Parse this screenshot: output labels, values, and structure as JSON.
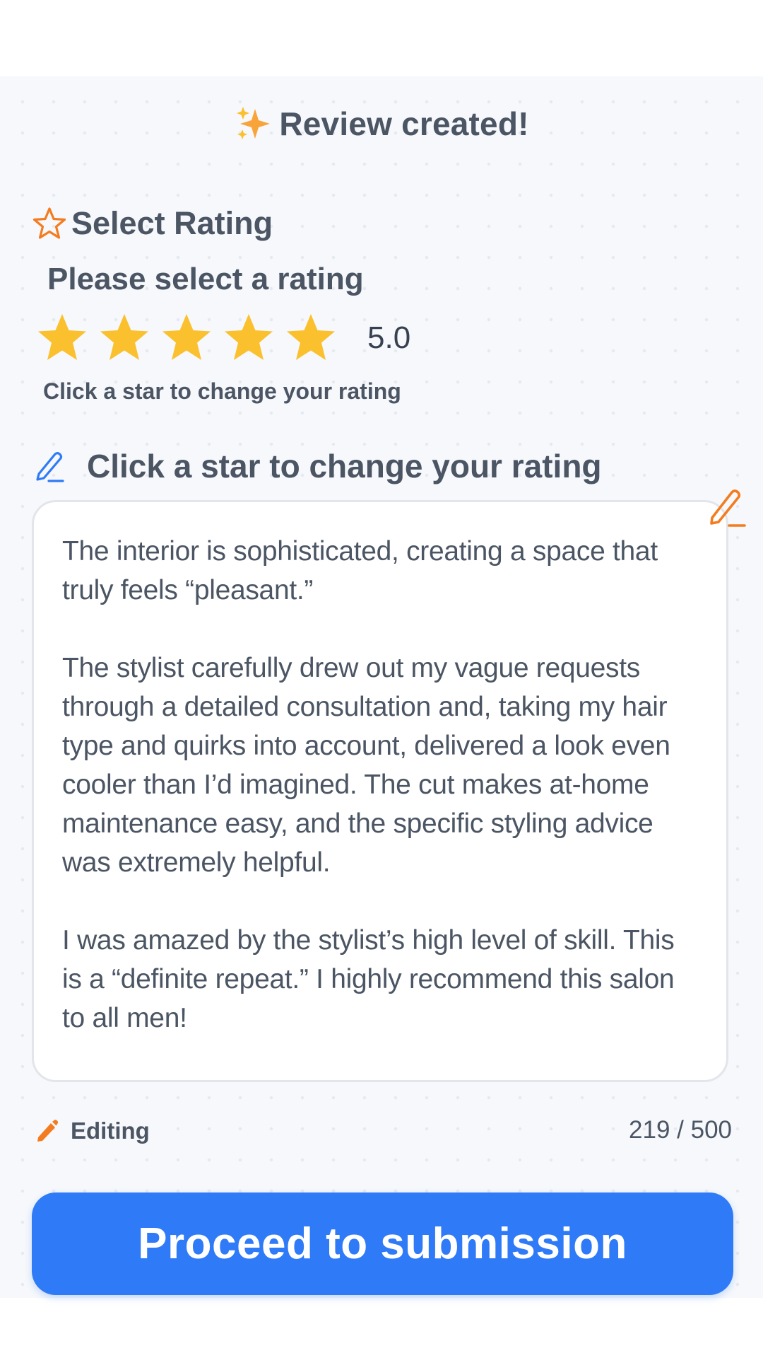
{
  "header": {
    "title": "Review created!",
    "icon": "sparkles-icon"
  },
  "rating_section": {
    "label": "Select Rating",
    "prompt": "Please select a rating",
    "rating": 5,
    "max_rating": 5,
    "value_label": "5.0",
    "hint": "Click a star to change your rating"
  },
  "review_section": {
    "label": "Click a star to change your rating",
    "paragraphs": [
      "The interior is sophisticated, creating a space that truly feels “pleasant.”",
      "The stylist carefully drew out my vague requests through a detailed consultation and, taking my hair type and quirks into account, delivered a look even cooler than I’d imagined. The cut makes at-home maintenance easy, and the specific styling advice was extremely helpful.",
      "I was amazed by the stylist’s high level of skill. This is a “definite repeat.” I highly recommend this salon to all men!"
    ]
  },
  "status": {
    "editing_label": "Editing",
    "char_count": "219 / 500"
  },
  "submit": {
    "label": "Proceed to submission"
  },
  "colors": {
    "accent_blue": "#2f7af7",
    "star_gold": "#fbc02d",
    "accent_orange": "#f47c20",
    "text_gray": "#4b5563",
    "background": "#f6f8fb"
  }
}
